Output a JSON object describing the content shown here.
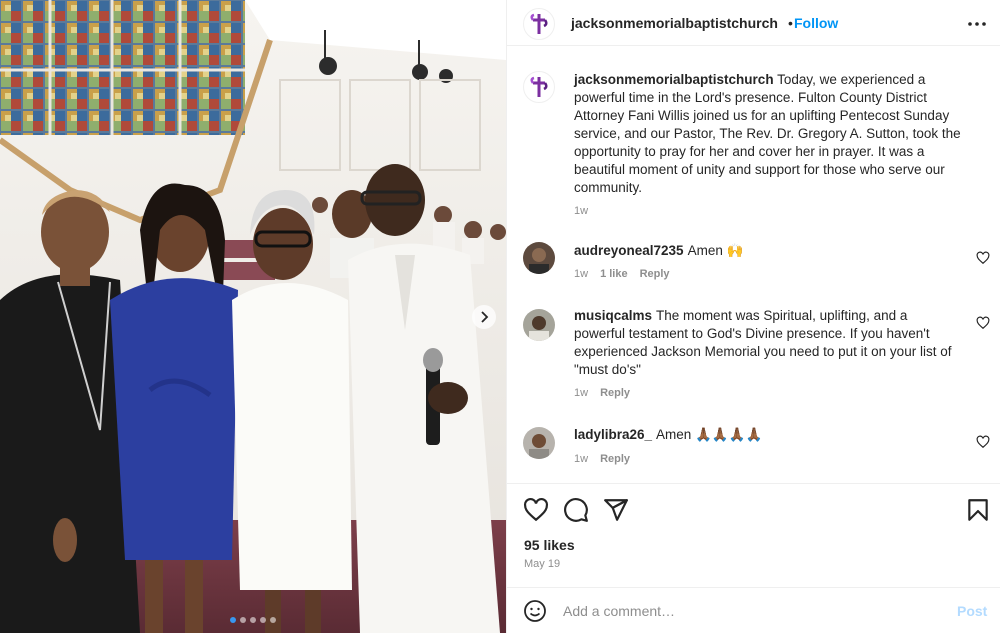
{
  "post": {
    "username": "jacksonmemorialbaptistchurch",
    "separator": "•",
    "follow_label": "Follow",
    "caption": "Today, we experienced a powerful time in the Lord's presence. Fulton County District Attorney Fani Willis joined us for an uplifting Pentecost Sunday service, and our Pastor, The Rev. Dr. Gregory A. Sutton, took the opportunity to pray for her and cover her in prayer. It was a beautiful moment of unity and support for those who serve our community.",
    "caption_time": "1w",
    "likes": "95 likes",
    "date": "May 19"
  },
  "comments": [
    {
      "username": "audreyoneal7235",
      "text": "Amen 🙌",
      "time": "1w",
      "likes": "1 like",
      "reply": "Reply"
    },
    {
      "username": "musiqcalms",
      "text": "The moment was Spiritual, uplifting, and a powerful testament to God's Divine presence. If you haven't experienced Jackson Memorial you need to put it on your list of \"must do's\"",
      "time": "1w",
      "reply": "Reply"
    },
    {
      "username": "ladylibra26_",
      "text": "Amen 🙏🏾🙏🏾🙏🏾🙏🏾",
      "time": "1w",
      "reply": "Reply"
    }
  ],
  "composer": {
    "placeholder": "Add a comment…",
    "post_label": "Post"
  },
  "carousel": {
    "count": 5,
    "active_index": 0
  },
  "icons": [
    "more-icon",
    "heart-icon",
    "comment-icon",
    "share-icon",
    "bookmark-icon",
    "emoji-icon",
    "chevron-right-icon"
  ],
  "colors": {
    "link": "#0095f6",
    "brand": "#7b2fa0",
    "muted": "#8e8e8e",
    "post_disabled": "#b3dbff"
  }
}
